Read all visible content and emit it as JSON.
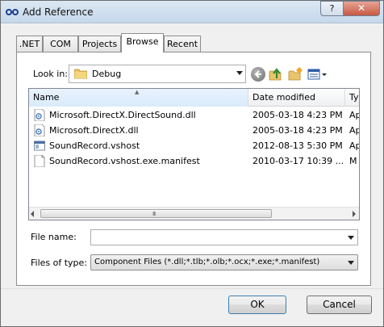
{
  "window": {
    "title": "Add Reference",
    "help_label": "?",
    "close_label": "✕"
  },
  "tabs": [
    {
      "label": ".NET"
    },
    {
      "label": "COM"
    },
    {
      "label": "Projects"
    },
    {
      "label": "Browse",
      "active": true
    },
    {
      "label": "Recent"
    }
  ],
  "look_in": {
    "label": "Look in:",
    "value": "Debug"
  },
  "toolbar_icons": [
    "back-icon",
    "up-folder-icon",
    "new-folder-icon",
    "views-menu-icon"
  ],
  "file_list": {
    "columns": [
      "Name",
      "Date modified",
      "Ty"
    ],
    "sorted_by": "Name",
    "rows": [
      {
        "name": "Microsoft.DirectX.DirectSound.dll",
        "date": "2005-03-18 4:23 PM",
        "type": "Ap",
        "icon": "dll-icon"
      },
      {
        "name": "Microsoft.DirectX.dll",
        "date": "2005-03-18 4:23 PM",
        "type": "Ap",
        "icon": "dll-icon"
      },
      {
        "name": "SoundRecord.vshost",
        "date": "2012-08-13 5:30 PM",
        "type": "Ap",
        "icon": "exe-icon"
      },
      {
        "name": "SoundRecord.vshost.exe.manifest",
        "date": "2010-03-17 10:39 ...",
        "type": "M",
        "icon": "file-icon"
      }
    ]
  },
  "scrollbar": {
    "grip": "III"
  },
  "file_name": {
    "label": "File name:",
    "value": ""
  },
  "file_type": {
    "label": "Files of type:",
    "value": "Component Files (*.dll;*.tlb;*.olb;*.ocx;*.exe;*.manifest)"
  },
  "buttons": {
    "ok": "OK",
    "cancel": "Cancel"
  }
}
